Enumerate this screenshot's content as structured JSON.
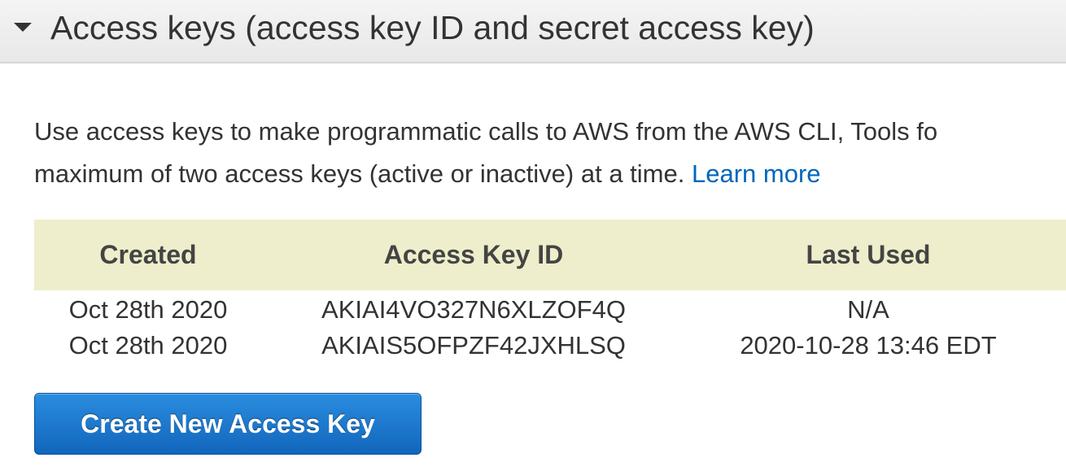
{
  "section": {
    "title": "Access keys (access key ID and secret access key)",
    "expanded": true
  },
  "intro": {
    "line1": "Use access keys to make programmatic calls to AWS from the AWS CLI, Tools fo",
    "line2": "maximum of two access keys (active or inactive) at a time.",
    "learn_more": "Learn more"
  },
  "table": {
    "headers": [
      "Created",
      "Access Key ID",
      "Last Used"
    ],
    "rows": [
      {
        "created": "Oct 28th 2020",
        "access_key_id": "AKIAI4VO327N6XLZOF4Q",
        "last_used": "N/A"
      },
      {
        "created": "Oct 28th 2020",
        "access_key_id": "AKIAIS5OFPZF42JXHLSQ",
        "last_used": "2020-10-28 13:46 EDT"
      }
    ]
  },
  "actions": {
    "create_label": "Create New Access Key"
  },
  "colors": {
    "header_bg": "#eeeecc",
    "link": "#0066bb",
    "button": "#1a73c8"
  },
  "icons": {
    "section_toggle": "caret-down-icon"
  }
}
